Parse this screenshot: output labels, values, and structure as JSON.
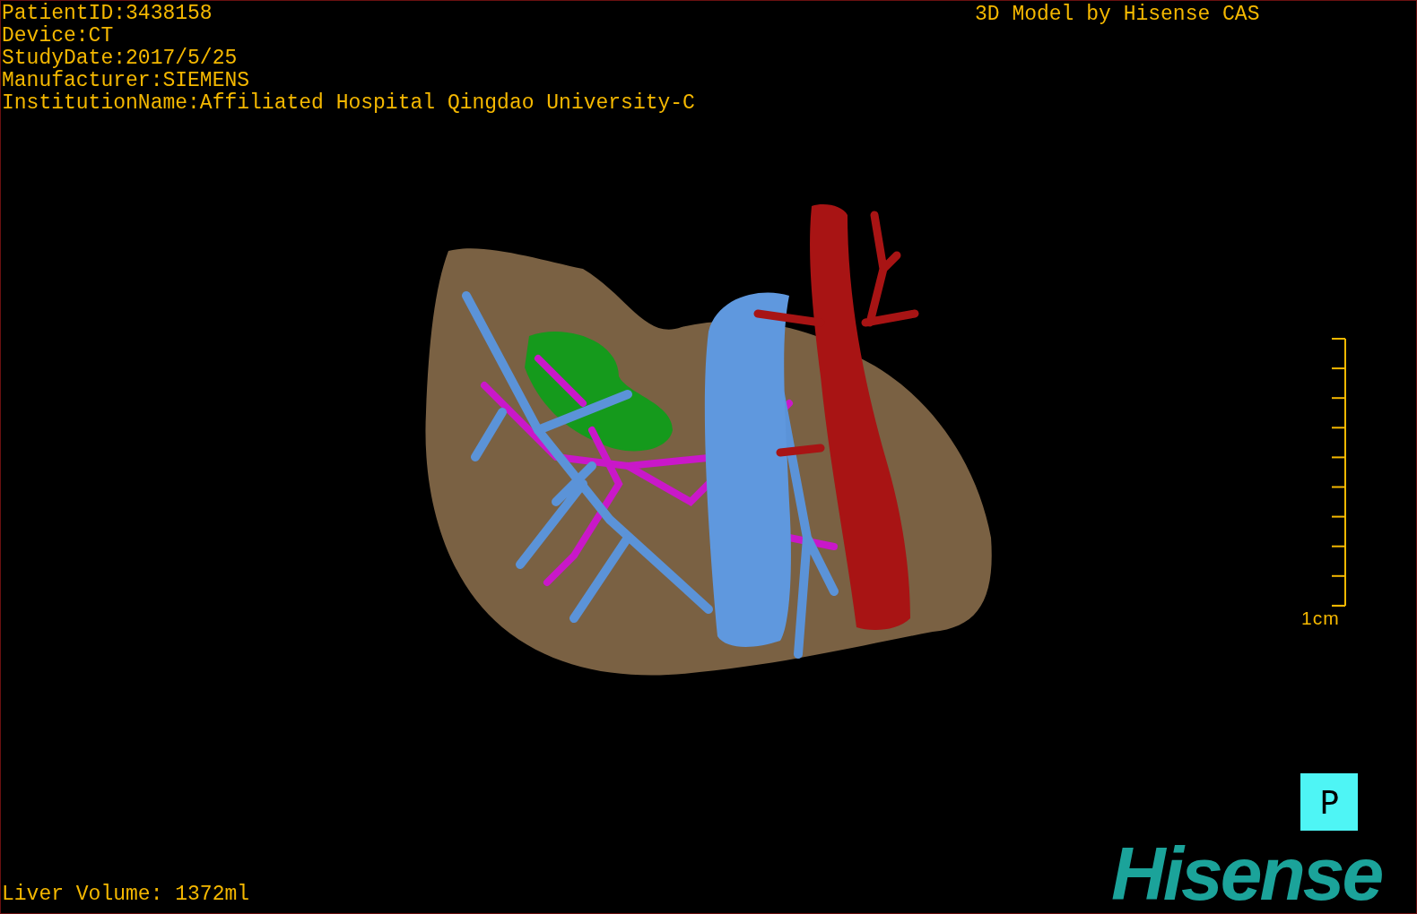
{
  "info_lines": [
    "PatientID:3438158",
    "Device:CT",
    "StudyDate:2017/5/25",
    "Manufacturer:SIEMENS",
    "InstitutionName:Affiliated Hospital Qingdao University-C"
  ],
  "title": "3D Model by Hisense CAS",
  "scale": {
    "label": "1cm"
  },
  "orientation": {
    "label": "P"
  },
  "volume": "Liver Volume: 1372ml",
  "logo": "Hisense"
}
